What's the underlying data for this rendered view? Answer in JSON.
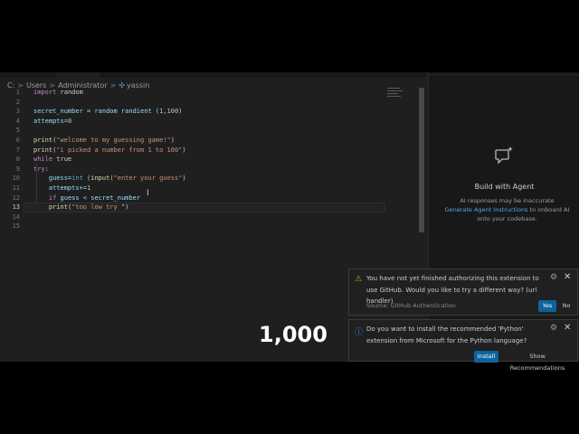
{
  "breadcrumb": {
    "drive": "C:",
    "sep": ">",
    "users": "Users",
    "admin": "Administrator",
    "file": "yassin"
  },
  "editor": {
    "line_numbers": [
      "1",
      "2",
      "3",
      "4",
      "5",
      "6",
      "7",
      "8",
      "9",
      "10",
      "11",
      "12",
      "13",
      "14",
      "15"
    ],
    "l1": {
      "kw": "import",
      "rest": " random"
    },
    "l3": {
      "a": "secret_number = random randient (",
      "num1": "1",
      "comma": ",",
      "num2": "100",
      "b": ")"
    },
    "l4": {
      "a": "attempts=",
      "num": "0"
    },
    "l6": {
      "fn": "print",
      "a": "(",
      "str": "\"welcome to my guessing game!\"",
      "b": ")"
    },
    "l7": {
      "fn": "print",
      "a": "(",
      "str": "\"i picked a number from 1 to 100\"",
      "b": ")"
    },
    "l8": {
      "kw": "while",
      "rest": " true"
    },
    "l9": {
      "kw": "try",
      "rest": ":"
    },
    "l10": {
      "indent": "    ",
      "a": "guess=",
      "int": "int",
      "sp": " (",
      "fn": "input",
      "b": "(",
      "str": "\"enter your guess\"",
      "c": ")"
    },
    "l11": {
      "indent": "    ",
      "a": "attempts+=",
      "num": "1"
    },
    "l12": {
      "indent": "    ",
      "kw": "if",
      "a": " guess < secret_number"
    },
    "l13": {
      "indent": "    ",
      "fn": "print",
      "a": "(",
      "str": "\"too low try ",
      "b": "\")"
    },
    "cursor": "I"
  },
  "sidebar": {
    "title": "Build with Agent",
    "desc_1": "AI responses may be inaccurate",
    "desc_link": "Generate Agent Instructions",
    "desc_2": " to onboard AI",
    "desc_3": "onto your codebase."
  },
  "toast1": {
    "icon": "⚠",
    "message": "You have not yet finished authorizing this extension to use GitHub. Would you like to try a different way? (url handler)",
    "source": "Source: GitHub Authentication",
    "yes": "Yes",
    "no": "No",
    "gear": "⚙",
    "close": "✕"
  },
  "toast2": {
    "icon": "ⓘ",
    "message": "Do you want to install the recommended 'Python' extension from Microsoft for the Python language?",
    "install": "Install",
    "show": "Show Recommendations",
    "gear": "⚙",
    "close": "✕"
  },
  "overlay": {
    "count": "1,000"
  },
  "colors": {
    "warning": "#cca700",
    "info": "#3794ff",
    "button": "#0e639c",
    "link": "#4daafc"
  }
}
